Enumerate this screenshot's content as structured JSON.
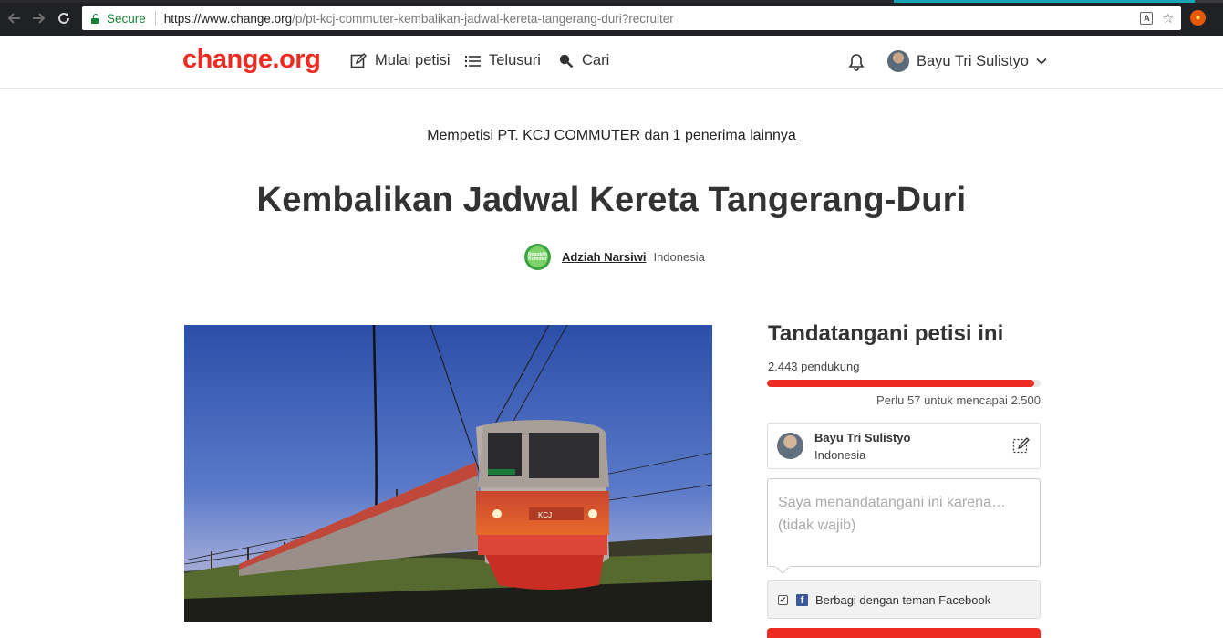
{
  "browser": {
    "secure_label": "Secure",
    "url_host": "https://www.change.org",
    "url_path": "/p/pt-kcj-commuter-kembalikan-jadwal-kereta-tangerang-duri?recruiter",
    "icons": [
      "back-icon",
      "forward-icon",
      "reload-icon",
      "lock-icon",
      "translate-icon",
      "star-icon",
      "extension-icon"
    ]
  },
  "header": {
    "logo": "change.org",
    "nav": {
      "start": "Mulai petisi",
      "browse": "Telusuri",
      "search": "Cari"
    },
    "user_name": "Bayu Tri Sulistyo"
  },
  "petition": {
    "to_prefix": "Mempetisi",
    "target": "PT. KCJ COMMUTER",
    "to_and": "dan",
    "others": "1 penerima lainnya",
    "title": "Kembalikan Jadwal Kereta Tangerang-Duri",
    "author_logo_text": "Republik Komuter",
    "author_name": "Adziah Narsiwi",
    "author_location": "Indonesia"
  },
  "sign": {
    "title": "Tandatangani petisi ini",
    "supporters": "2.443 pendukung",
    "progress_fraction": 0.9772,
    "need_text": "Perlu 57 untuk mencapai 2.500",
    "signer_name": "Bayu Tri Sulistyo",
    "signer_location": "Indonesia",
    "reason_placeholder": "Saya menandatangani ini karena… (tidak wajib)",
    "facebook_share": "Berbagi dengan teman Facebook",
    "facebook_checked": true
  },
  "colors": {
    "brand_red": "#ec2c22",
    "facebook_blue": "#3b5998",
    "secure_green": "#188038"
  }
}
